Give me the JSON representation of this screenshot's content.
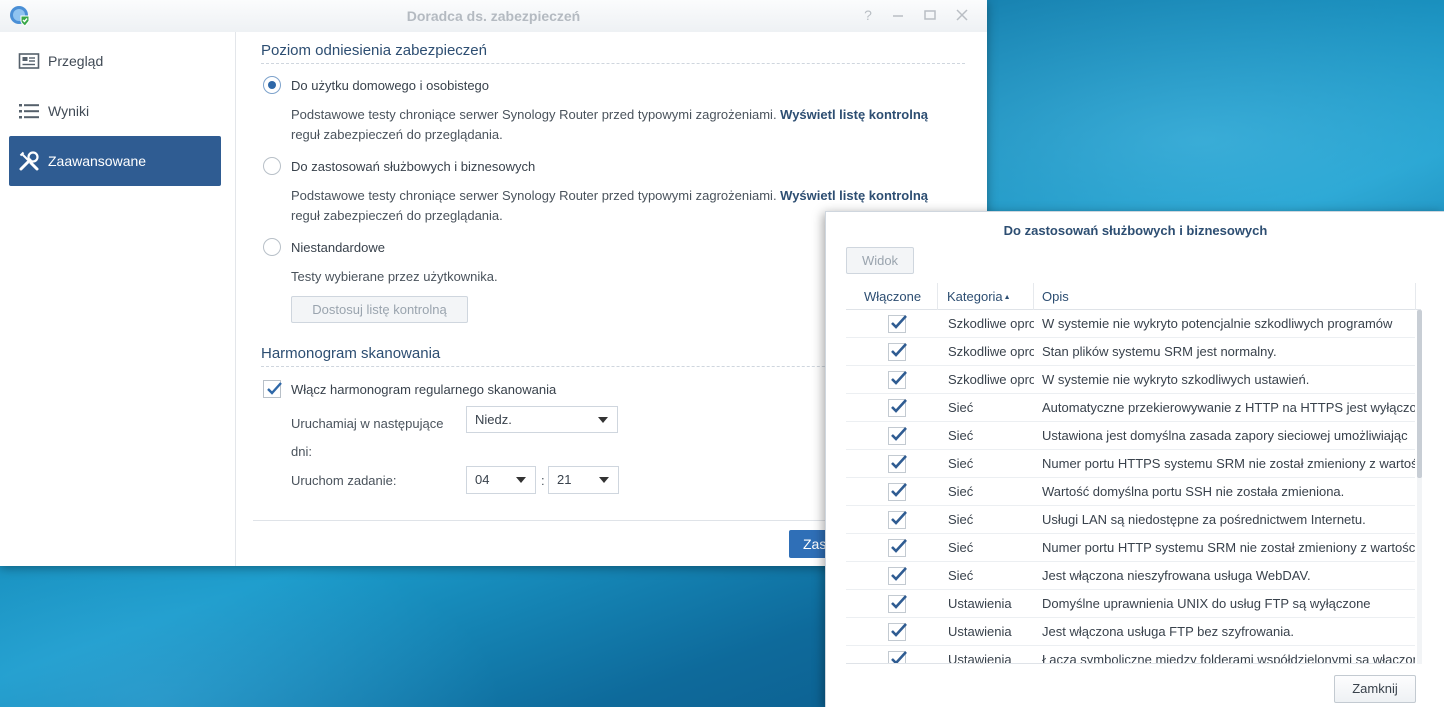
{
  "window": {
    "title": "Doradca ds. zabezpieczeń",
    "icons": [
      "security-advisor-app-icon",
      "help-icon",
      "minimize-icon",
      "maximize-icon",
      "close-icon"
    ]
  },
  "sidebar": {
    "items": [
      {
        "label": "Przegląd",
        "icon": "overview-icon",
        "active": false
      },
      {
        "label": "Wyniki",
        "icon": "list-icon",
        "active": false
      },
      {
        "label": "Zaawansowane",
        "icon": "wrench-icon",
        "active": true
      }
    ]
  },
  "baseline": {
    "section_title": "Poziom odniesienia zabezpieczeń",
    "options": [
      {
        "label": "Do użytku domowego i osobistego",
        "selected": true,
        "desc_prefix": "Podstawowe testy chroniące serwer Synology Router przed typowymi zagrożeniami. ",
        "desc_link": "Wyświetl listę kontrolną",
        "desc_suffix": " reguł zabezpieczeń do przeglądania."
      },
      {
        "label": "Do zastosowań służbowych i biznesowych",
        "selected": false,
        "desc_prefix": "Podstawowe testy chroniące serwer Synology Router przed typowymi zagrożeniami. ",
        "desc_link": "Wyświetl listę kontrolną",
        "desc_suffix": " reguł zabezpieczeń do przeglądania."
      },
      {
        "label": "Niestandardowe",
        "selected": false,
        "desc": "Testy wybierane przez użytkownika.",
        "button": "Dostosuj listę kontrolną"
      }
    ]
  },
  "schedule": {
    "section_title": "Harmonogram skanowania",
    "enable_label": "Włącz harmonogram regularnego skanowania",
    "enabled": true,
    "days_label": "Uruchamiaj w następujące dni:",
    "days_value": "Niedz.",
    "time_label": "Uruchom zadanie:",
    "hour": "04",
    "separator": ":",
    "minute": "21"
  },
  "footer": {
    "apply_label": "Zas"
  },
  "dialog": {
    "title": "Do zastosowań służbowych i biznesowych",
    "view_button": "Widok",
    "columns": {
      "enabled": "Włączone",
      "category": "Kategoria",
      "description": "Opis"
    },
    "sort_indicator": "▲",
    "rows": [
      {
        "checked": true,
        "category": "Szkodliwe oprogramowanie",
        "description": "W systemie nie wykryto potencjalnie szkodliwych programów"
      },
      {
        "checked": true,
        "category": "Szkodliwe oprogramowanie",
        "description": "Stan plików systemu SRM jest normalny."
      },
      {
        "checked": true,
        "category": "Szkodliwe oprogramowanie",
        "description": "W systemie nie wykryto szkodliwych ustawień."
      },
      {
        "checked": true,
        "category": "Sieć",
        "description": "Automatyczne przekierowywanie z HTTP na HTTPS jest wyłączone"
      },
      {
        "checked": true,
        "category": "Sieć",
        "description": "Ustawiona jest domyślna zasada zapory sieciowej umożliwiając"
      },
      {
        "checked": true,
        "category": "Sieć",
        "description": "Numer portu HTTPS systemu SRM nie został zmieniony z wartości"
      },
      {
        "checked": true,
        "category": "Sieć",
        "description": "Wartość domyślna portu SSH nie została zmieniona."
      },
      {
        "checked": true,
        "category": "Sieć",
        "description": "Usługi LAN są niedostępne za pośrednictwem Internetu."
      },
      {
        "checked": true,
        "category": "Sieć",
        "description": "Numer portu HTTP systemu SRM nie został zmieniony z wartości"
      },
      {
        "checked": true,
        "category": "Sieć",
        "description": "Jest włączona nieszyfrowana usługa WebDAV."
      },
      {
        "checked": true,
        "category": "Ustawienia",
        "description": "Domyślne uprawnienia UNIX do usług FTP są wyłączone"
      },
      {
        "checked": true,
        "category": "Ustawienia",
        "description": "Jest włączona usługa FTP bez szyfrowania."
      },
      {
        "checked": true,
        "category": "Ustawienia",
        "description": "Łącza symboliczne między folderami współdzielonymi są włączone"
      }
    ],
    "close_button": "Zamknij"
  }
}
